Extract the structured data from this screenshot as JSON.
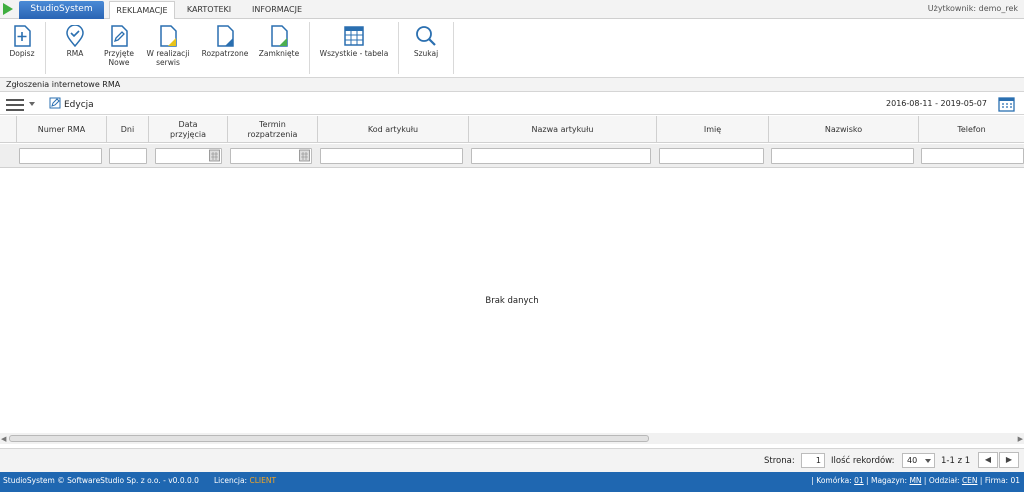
{
  "topbar": {
    "brand": "StudioSystem",
    "tabs": [
      {
        "label": "REKLAMACJE",
        "active": true
      },
      {
        "label": "KARTOTEKI",
        "active": false
      },
      {
        "label": "INFORMACJE",
        "active": false
      }
    ],
    "user": "Użytkownik: demo_rek"
  },
  "ribbon": {
    "buttons": [
      {
        "label": "Dopisz",
        "icon": "add-document-icon"
      },
      {
        "label": "RMA",
        "icon": "map-pin-check-icon"
      },
      {
        "label": "Przyjęte",
        "label2": "Nowe",
        "icon": "edit-document-icon"
      },
      {
        "label": "W realizacji",
        "label2": "serwis",
        "icon": "document-yellow-icon"
      },
      {
        "label": "Rozpatrzone",
        "icon": "document-blue-icon"
      },
      {
        "label": "Zamknięte",
        "icon": "document-green-icon"
      },
      {
        "label": "Wszystkie - tabela",
        "icon": "table-icon"
      },
      {
        "label": "Szukaj",
        "icon": "magnifier-icon"
      }
    ]
  },
  "section_title": "Zgłoszenia internetowe RMA",
  "toolbar": {
    "edit_label": "Edycja",
    "date_range": "2016-08-11 - 2019-05-07"
  },
  "grid": {
    "columns": [
      {
        "line1": "Numer RMA",
        "line2": ""
      },
      {
        "line1": "Dni",
        "line2": ""
      },
      {
        "line1": "Data",
        "line2": "przyjęcia"
      },
      {
        "line1": "Termin",
        "line2": "rozpatrzenia"
      },
      {
        "line1": "Kod artykułu",
        "line2": ""
      },
      {
        "line1": "Nazwa artykułu",
        "line2": ""
      },
      {
        "line1": "Imię",
        "line2": ""
      },
      {
        "line1": "Nazwisko",
        "line2": ""
      },
      {
        "line1": "Telefon",
        "line2": ""
      }
    ],
    "empty_message": "Brak danych"
  },
  "pager": {
    "page_label": "Strona:",
    "page_value": "1",
    "records_label": "Ilość rekordów:",
    "records_value": "40",
    "count_text": "1-1 z 1",
    "prev": "◀",
    "next": "▶"
  },
  "status": {
    "copyright": "StudioSystem © SoftwareStudio Sp. z o.o. - v0.0.0.0",
    "license_label": "Licencja:",
    "license_value": "CLIENT",
    "komorka_label": "Komórka:",
    "komorka_value": "01",
    "magazyn_label": "Magazyn:",
    "magazyn_value": "MN",
    "oddzial_label": "Oddział:",
    "oddzial_value": "CEN",
    "firma_label": "Firma:",
    "firma_value": "01"
  },
  "colors": {
    "brand_blue": "#2a64b4",
    "status_blue": "#1f67b1",
    "license_orange": "#f5a623",
    "play_green": "#3fae3f"
  }
}
